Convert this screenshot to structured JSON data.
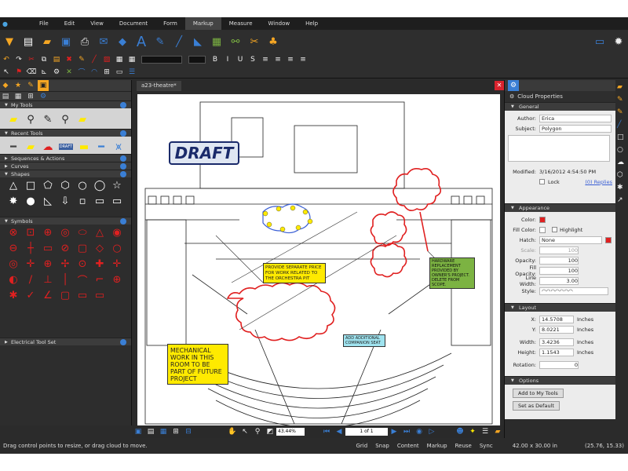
{
  "menubar": {
    "items": [
      "File",
      "Edit",
      "View",
      "Document",
      "Form",
      "Markup",
      "Measure",
      "Window",
      "Help"
    ],
    "active": "Markup"
  },
  "left_panel": {
    "my_tools": "My Tools",
    "recent_tools": "Recent Tools",
    "sequences": "Sequences & Actions",
    "curves": "Curves",
    "shapes": "Shapes",
    "symbols": "Symbols",
    "electrical": "Electrical Tool Set",
    "draft_label": "DRAFT"
  },
  "document": {
    "tab_name": "a23-theatre*",
    "draft_stamp": "DRAFT",
    "mechanical_note": "MECHANICAL WORK IN THIS ROOM TO BE PART OF FUTURE PROJECT",
    "provide_note": "PROVIDE SEPARATE PRICE FOR WORK RELATED TO THE ORCHESTRA PIT",
    "hardware_note": "HARDWARE REPLACEMENT PROVIDED BY OWNER'S PROJECT. DELETE FROM SCOPE.",
    "companion_note": "ADD ADDITIONAL COMPANION SEAT"
  },
  "navbar": {
    "zoom": "43.44%",
    "page": "1 of 1"
  },
  "properties": {
    "title": "Cloud Properties",
    "general": "General",
    "author_label": "Author:",
    "author": "Erica",
    "subject_label": "Subject:",
    "subject": "Polygon",
    "modified_label": "Modified:",
    "modified": "3/16/2012 4:54:50 PM",
    "lock": "Lock",
    "replies": "(0) Replies",
    "appearance": "Appearance",
    "color_label": "Color:",
    "fill_color_label": "Fill Color:",
    "highlight": "Highlight",
    "hatch_label": "Hatch:",
    "hatch": "None",
    "scale_label": "Scale:",
    "scale": "100",
    "opacity_label": "Opacity:",
    "opacity": "100",
    "fill_opacity_label": "Fill Opacity:",
    "fill_opacity": "100",
    "line_width_label": "Line Width:",
    "line_width": "3.00",
    "style_label": "Style:",
    "layout": "Layout",
    "x_label": "X:",
    "x": "14.5708",
    "y_label": "Y:",
    "y": "8.0221",
    "width_label": "Width:",
    "width": "3.4236",
    "height_label": "Height:",
    "height": "1.1543",
    "rotation_label": "Rotation:",
    "rotation": "0",
    "unit": "Inches",
    "options": "Options",
    "add_btn": "Add to My Tools",
    "default_btn": "Set as Default"
  },
  "status": {
    "message": "Drag control points to resize, or drag cloud to move.",
    "grid": "Grid",
    "snap": "Snap",
    "content": "Content",
    "markup": "Markup",
    "reuse": "Reuse",
    "sync": "Sync",
    "size": "42.00 x 30.00 in",
    "coords": "(25.76, 15.33)"
  },
  "colors": {
    "accent": "#f5a623",
    "blue": "#3a7fd5",
    "cloud": "#e02020"
  }
}
